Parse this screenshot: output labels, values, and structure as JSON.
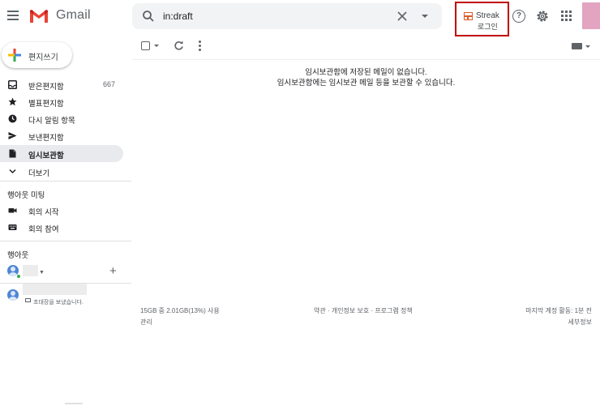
{
  "header": {
    "app_name": "Gmail",
    "search_value": "in:draft",
    "streak": {
      "name": "Streak",
      "action": "로그인"
    }
  },
  "sidebar": {
    "compose_label": "편지쓰기",
    "items": [
      {
        "label": "받은편지함",
        "icon": "inbox-icon",
        "count": "667"
      },
      {
        "label": "별표편지함",
        "icon": "star-icon",
        "count": ""
      },
      {
        "label": "다시 알림 항목",
        "icon": "clock-icon",
        "count": ""
      },
      {
        "label": "보낸편지함",
        "icon": "send-icon",
        "count": ""
      },
      {
        "label": "임시보관함",
        "icon": "draft-icon",
        "count": "",
        "active": true
      },
      {
        "label": "더보기",
        "icon": "chevron-down-icon",
        "count": ""
      }
    ],
    "meet": {
      "title": "행아웃 미팅",
      "start": "회의 시작",
      "join": "회의 참여"
    },
    "hangouts": {
      "title": "행아웃",
      "invite_status": "초대장을 보냈습니다."
    }
  },
  "main": {
    "empty_line1": "임시보관함에 저장된 메일이 없습니다.",
    "empty_line2": "임시보관함에는 임시보관 메일 등을 보관할 수 있습니다."
  },
  "footer": {
    "storage": "15GB 중 2.01GB(13%) 사용",
    "manage": "관리",
    "links": "약관 · 개인정보 보호 · 프로그램 정책",
    "last_activity": "마지막 계정 활동: 1분 전",
    "details": "세부정보"
  },
  "colors": {
    "gmail_red": "#ea4335",
    "streak_highlight": "#c00000",
    "active_nav": "#e8eaed",
    "online": "#34a853"
  }
}
